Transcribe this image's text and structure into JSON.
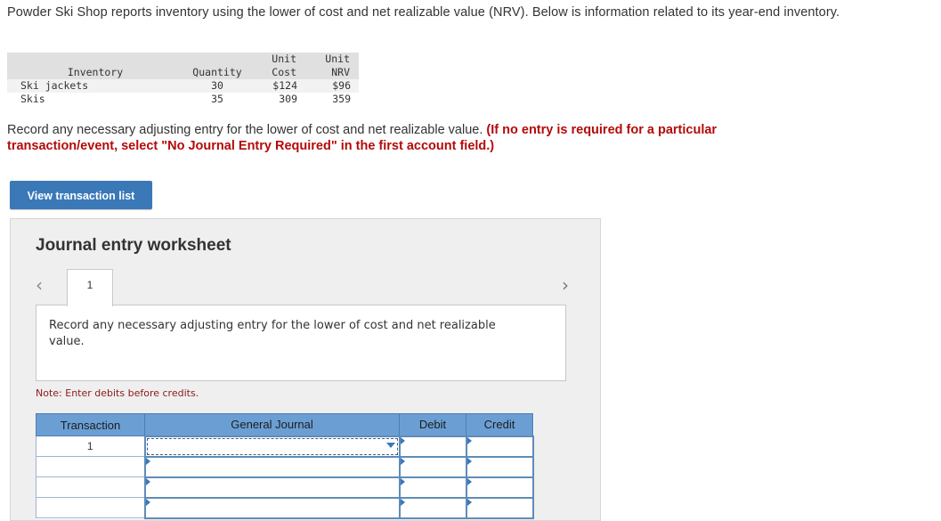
{
  "intro": "Powder Ski Shop reports inventory using the lower of cost and net realizable value (NRV). Below is information related to its year-end inventory.",
  "inventory_table": {
    "headers": {
      "inventory": "Inventory",
      "quantity": "Quantity",
      "unit_cost_1": "Unit",
      "unit_cost_2": "Cost",
      "unit_nrv_1": "Unit",
      "unit_nrv_2": "NRV"
    },
    "rows": [
      {
        "item": "Ski jackets",
        "quantity": "30",
        "unit_cost": "$124",
        "unit_nrv": "$96"
      },
      {
        "item": "Skis",
        "quantity": "35",
        "unit_cost": "309",
        "unit_nrv": "359"
      }
    ]
  },
  "instruction": {
    "text": "Record any necessary adjusting entry for the lower of cost and net realizable value.",
    "red_text": "(If no entry is required for a particular transaction/event, select \"No Journal Entry Required\" in the first account field.)"
  },
  "view_button_label": "View transaction list",
  "worksheet": {
    "title": "Journal entry worksheet",
    "prev_icon": "chevron-left-icon",
    "next_icon": "chevron-right-icon",
    "active_tab": "1",
    "description": "Record any necessary adjusting entry for the lower of cost and net realizable value.",
    "note": "Note: Enter debits before credits.",
    "table": {
      "headers": {
        "transaction": "Transaction",
        "general_journal": "General Journal",
        "debit": "Debit",
        "credit": "Credit"
      },
      "rows": [
        {
          "transaction": "1",
          "general_journal": "",
          "debit": "",
          "credit": ""
        },
        {
          "transaction": "",
          "general_journal": "",
          "debit": "",
          "credit": ""
        },
        {
          "transaction": "",
          "general_journal": "",
          "debit": "",
          "credit": ""
        },
        {
          "transaction": "",
          "general_journal": "",
          "debit": "",
          "credit": ""
        }
      ]
    }
  },
  "colors": {
    "button_blue": "#3a78b8",
    "table_header_blue": "#6b9fd4",
    "red_instruction": "#b40a0a",
    "note_red": "#8b1a1a"
  }
}
